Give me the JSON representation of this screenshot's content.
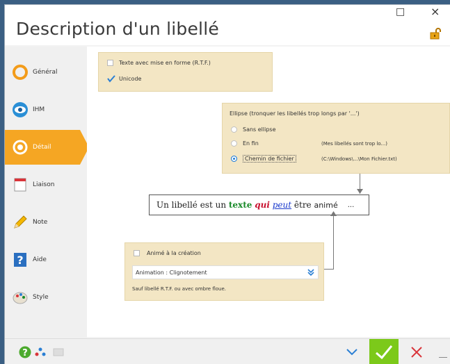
{
  "window": {
    "title": "Description d'un libellé",
    "buttons": {
      "maximize": "□",
      "close": "×"
    }
  },
  "sidebar": {
    "items": [
      {
        "label": "Général",
        "icon": "general-icon"
      },
      {
        "label": "IHM",
        "icon": "eye-icon"
      },
      {
        "label": "Détail",
        "icon": "detail-icon",
        "active": true
      },
      {
        "label": "Liaison",
        "icon": "link-icon"
      },
      {
        "label": "Note",
        "icon": "pencil-icon"
      },
      {
        "label": "Aide",
        "icon": "help-icon"
      },
      {
        "label": "Style",
        "icon": "palette-icon"
      }
    ]
  },
  "format_panel": {
    "rtf_label": "Texte avec mise en forme (R.T.F.)",
    "rtf_checked": false,
    "unicode_label": "Unicode",
    "unicode_checked": true
  },
  "ellipsis_panel": {
    "title": "Ellipse (tronquer les libellés trop longs par '...')",
    "options": [
      {
        "label": "Sans ellipse",
        "note": "",
        "selected": false
      },
      {
        "label": "En fin",
        "note": "(Mes libellés sont trop lo...)",
        "selected": false
      },
      {
        "label": "Chemin de fichier",
        "note": "(C:\\Windows\\...\\Mon Fichier.txt)",
        "selected": true
      }
    ]
  },
  "preview": {
    "part1": "Un libellé est un ",
    "texte": "texte",
    "qui": "qui",
    "peut": "peut",
    "etre": " être ",
    "anime": "animé",
    "ellipsis": "...",
    "colors": {
      "texte": "#1a8a2a",
      "qui": "#c8102e",
      "peut": "#1a3acc"
    }
  },
  "animation_panel": {
    "checkbox_label": "Animé à la création",
    "checked": false,
    "select_value": "Animation : Clignotement",
    "note": "Sauf libellé R.T.F. ou avec ombre floue."
  },
  "footer": {
    "help": "?",
    "dropdown": "⌄",
    "ok": "✓",
    "cancel": "×"
  },
  "colors": {
    "accent": "#f5a623",
    "panel": "#f3e6c4",
    "ok": "#7cc91a",
    "cancel": "#d9343a",
    "blue": "#2a7fd4"
  }
}
